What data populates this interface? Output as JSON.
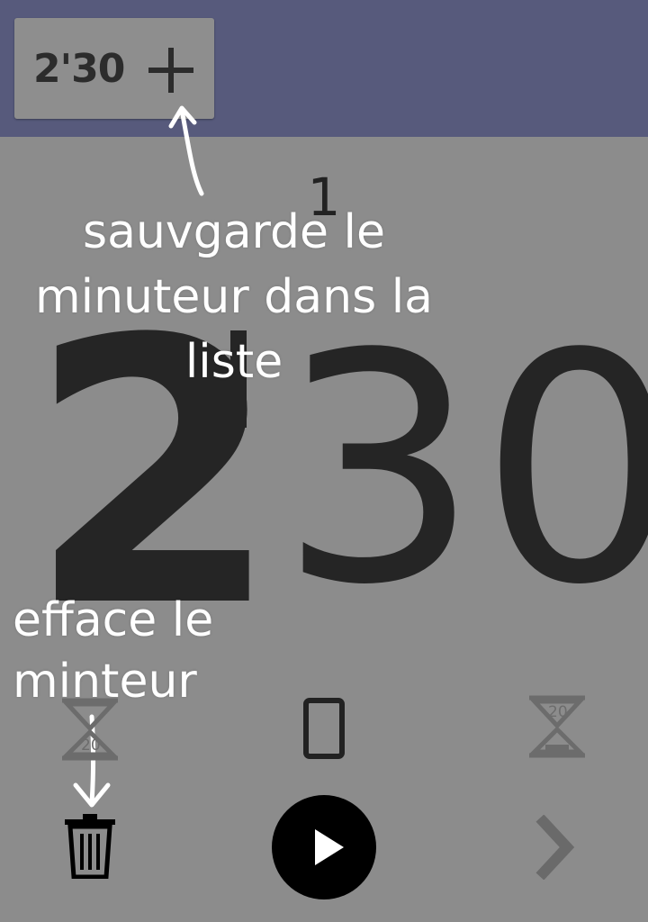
{
  "topbar": {
    "saved_timer": "2'30",
    "add_label": "+"
  },
  "main": {
    "counter": "1",
    "minutes": "2",
    "seconds": "30"
  },
  "annotations": {
    "save_note": "sauvgarde le minuteur dans la liste",
    "delete_note": "efface le minteur"
  },
  "icons": {
    "left_hourglass_number": "20",
    "right_hourglass_number": "20",
    "left_hourglass": "hourglass-icon",
    "phone": "phone-icon",
    "right_hourglass": "hourglass-icon",
    "trash": "trash-icon",
    "play": "play-icon",
    "next": "chevron-right-icon"
  },
  "colors": {
    "topbar": "#575a7c",
    "background": "#8c8c8c",
    "text_dark": "#252525",
    "annotation": "#ffffff"
  }
}
